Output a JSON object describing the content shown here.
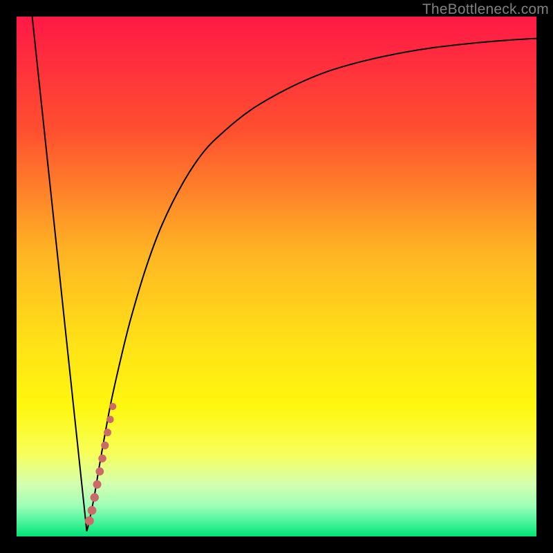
{
  "watermark": "TheBottleneck.com",
  "colors": {
    "frame": "#000000",
    "curve_stroke": "#000000",
    "dot_fill": "#cc6a6a",
    "gradient_stops": [
      {
        "t": 0.0,
        "c": "#ff1946"
      },
      {
        "t": 0.22,
        "c": "#ff5030"
      },
      {
        "t": 0.45,
        "c": "#ffb424"
      },
      {
        "t": 0.62,
        "c": "#ffe018"
      },
      {
        "t": 0.75,
        "c": "#fff80f"
      },
      {
        "t": 0.84,
        "c": "#f8ff5a"
      },
      {
        "t": 0.9,
        "c": "#d4ffb0"
      },
      {
        "t": 0.94,
        "c": "#a0ffb8"
      },
      {
        "t": 0.97,
        "c": "#50f5a0"
      },
      {
        "t": 1.0,
        "c": "#00e676"
      }
    ]
  },
  "chart_data": {
    "type": "line",
    "title": "",
    "xlabel": "",
    "ylabel": "",
    "xlim": [
      0,
      100
    ],
    "ylim": [
      0,
      100
    ],
    "grid": false,
    "series": [
      {
        "name": "bottleneck-curve",
        "x": [
          3,
          6,
          8,
          10,
          12,
          13,
          13.5,
          14,
          15,
          16,
          18,
          20,
          22,
          25,
          28,
          32,
          36,
          40,
          45,
          50,
          55,
          60,
          65,
          70,
          75,
          80,
          85,
          90,
          95,
          100
        ],
        "values": [
          100,
          70,
          50,
          30,
          12,
          4,
          1,
          3,
          8,
          14,
          25,
          34,
          42,
          52,
          60,
          68,
          74,
          78,
          82,
          85,
          87.5,
          89.5,
          91,
          92.2,
          93.2,
          94,
          94.6,
          95.1,
          95.5,
          95.8
        ]
      }
    ],
    "minimum": {
      "x": 13.5,
      "y": 1
    },
    "dots": {
      "name": "highlight-dots",
      "points": [
        {
          "x": 14.0,
          "y": 3.0
        },
        {
          "x": 14.5,
          "y": 5.0
        },
        {
          "x": 15.0,
          "y": 7.5
        },
        {
          "x": 15.5,
          "y": 10.0
        },
        {
          "x": 16.0,
          "y": 12.5
        },
        {
          "x": 16.5,
          "y": 15.0
        },
        {
          "x": 17.0,
          "y": 17.5
        },
        {
          "x": 17.5,
          "y": 20.0
        },
        {
          "x": 18.0,
          "y": 22.5
        },
        {
          "x": 18.5,
          "y": 25.0
        }
      ]
    }
  }
}
